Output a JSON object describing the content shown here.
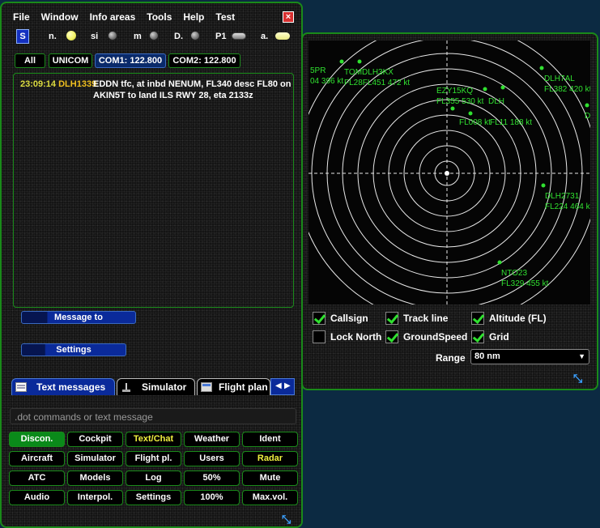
{
  "menu": [
    "File",
    "Window",
    "Info areas",
    "Tools",
    "Help",
    "Test"
  ],
  "close_icon": "×",
  "status": {
    "s_badge": "S",
    "items": [
      {
        "label": "n.",
        "type": "led-yellow"
      },
      {
        "label": "si",
        "type": "led-gray"
      },
      {
        "label": "m",
        "type": "led-gray"
      },
      {
        "label": "D.",
        "type": "led-gray"
      },
      {
        "label": "P1",
        "type": "pill-gray"
      },
      {
        "label": "a.",
        "type": "pill-yellow"
      }
    ]
  },
  "channel_tabs": [
    "All",
    "UNICOM",
    "COM1: 122.800",
    "COM2: 122.800"
  ],
  "message": {
    "time": "23:09:14",
    "callsign": "DLH1339",
    "text": "EDDN tfc, at inbd NENUM, FL340 desc FL80 on AKIN5T to land ILS RWY 28, eta 2133z"
  },
  "buttons": {
    "message_to": "Message to",
    "settings": "Settings"
  },
  "bottom_tabs": [
    "Text messages",
    "Simulator",
    "Flight plan"
  ],
  "input_placeholder": ".dot commands or text message",
  "grid_buttons": [
    [
      "Discon.",
      "Cockpit",
      "Text/Chat",
      "Weather",
      "Ident"
    ],
    [
      "Aircraft",
      "Simulator",
      "Flight pl.",
      "Users",
      "Radar"
    ],
    [
      "ATC",
      "Models",
      "Log",
      "50%",
      "Mute"
    ],
    [
      "Audio",
      "Interpol.",
      "Settings",
      "100%",
      "Max.vol."
    ]
  ],
  "radar": {
    "colors": {
      "rings": "#e8e8e8",
      "traffic": "#30e030"
    },
    "aircraft_labels": [
      "5PR",
      "04 396 kt",
      "TOMDLH3KX",
      "FL28FL451 472 kt",
      "EZY15KQ",
      "FL355 530 kt",
      "DLH",
      "DLH7AL",
      "FL382 420 kt",
      "FL008 kt",
      "FL11 188 kt",
      "DLH2731",
      "FL224 464 kt",
      "NTO23",
      "FL329 455 kt",
      "D"
    ],
    "options": [
      {
        "label": "Callsign",
        "checked": true
      },
      {
        "label": "Track line",
        "checked": true
      },
      {
        "label": "Altitude (FL)",
        "checked": true
      },
      {
        "label": "Lock North",
        "checked": false
      },
      {
        "label": "GroundSpeed",
        "checked": true
      },
      {
        "label": "Grid",
        "checked": true
      }
    ],
    "range_label": "Range",
    "range_value": "80 nm"
  }
}
